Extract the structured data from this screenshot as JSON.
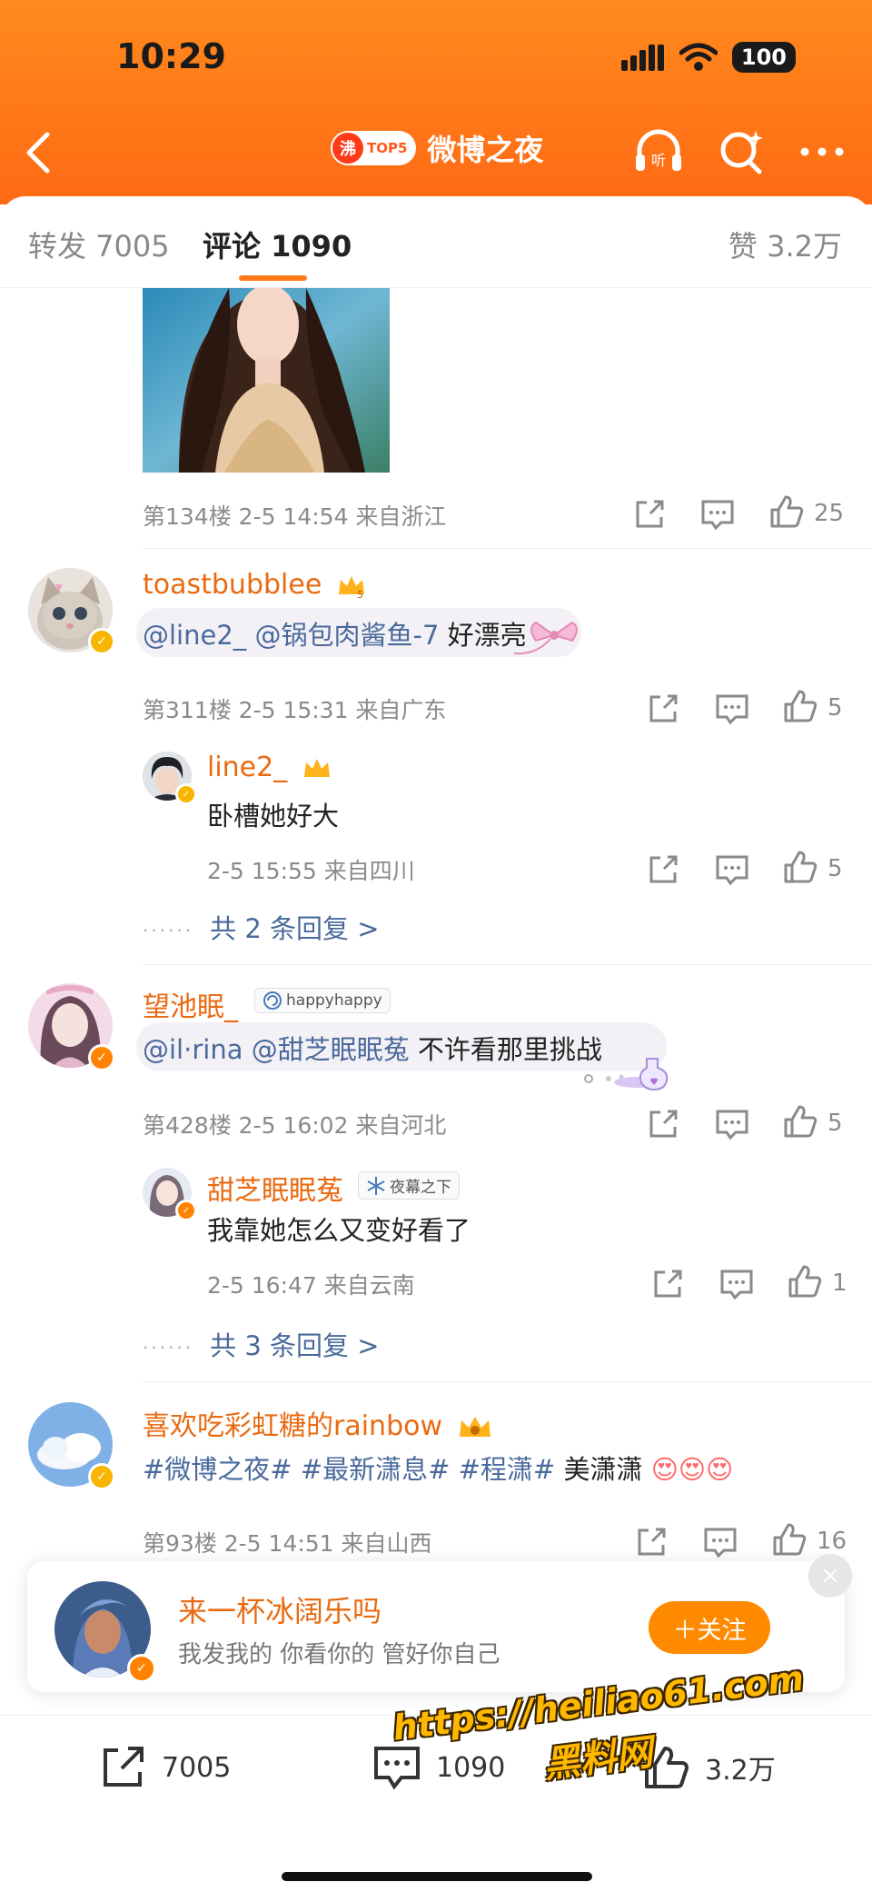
{
  "status_bar": {
    "time": "10:29",
    "battery": "100"
  },
  "nav": {
    "badge_icon_text": "沸",
    "badge_text": "TOP5",
    "title": "微博之夜"
  },
  "tabs": {
    "repost": "转发 7005",
    "comment": "评论 1090",
    "like": "赞 3.2万"
  },
  "comments": [
    {
      "floor_meta": "第134楼  2-5 14:54  来自浙江",
      "likes": "25"
    },
    {
      "username": "toastbubblee",
      "mention1": "@line2_",
      "mention2": "@锅包肉酱鱼-7",
      "text": "好漂亮",
      "meta": "第311楼  2-5 15:31  来自广东",
      "likes": "5",
      "reply": {
        "username": "line2_",
        "text": "卧槽她好大",
        "meta": "2-5 15:55  来自四川",
        "likes": "5"
      },
      "more_replies": "共 2 条回复 >"
    },
    {
      "username": "望池眠_",
      "tag": "happyhappy",
      "mention1": "@il·rina",
      "mention2": "@甜芝眠眠菟",
      "text": "不许看那里挑战",
      "meta": "第428楼  2-5 16:02  来自河北",
      "likes": "5",
      "reply": {
        "username": "甜芝眠眠菟",
        "tag": "夜幕之下",
        "text": "我靠她怎么又变好看了",
        "meta": "2-5 16:47  来自云南",
        "likes": "1"
      },
      "more_replies": "共 3 条回复 >"
    },
    {
      "username": "喜欢吃彩虹糖的rainbow",
      "hashtags": "#微博之夜#  #最新潇息#  #程潇#",
      "text": "美潇潇",
      "meta": "第93楼  2-5 14:51  来自山西",
      "likes": "16"
    }
  ],
  "follow_card": {
    "name": "来一杯冰阔乐吗",
    "subtitle": "我发我的 你看你的 管好你自己",
    "button": "＋关注"
  },
  "bottom_bar": {
    "repost": "7005",
    "comment": "1090",
    "like": "3.2万"
  },
  "watermark": {
    "url": "https://heiliao61.com",
    "cn": "黑料网"
  },
  "colors": {
    "accent": "#ff7a1a",
    "username": "#ea6a12",
    "mention": "#4a6a9c"
  }
}
